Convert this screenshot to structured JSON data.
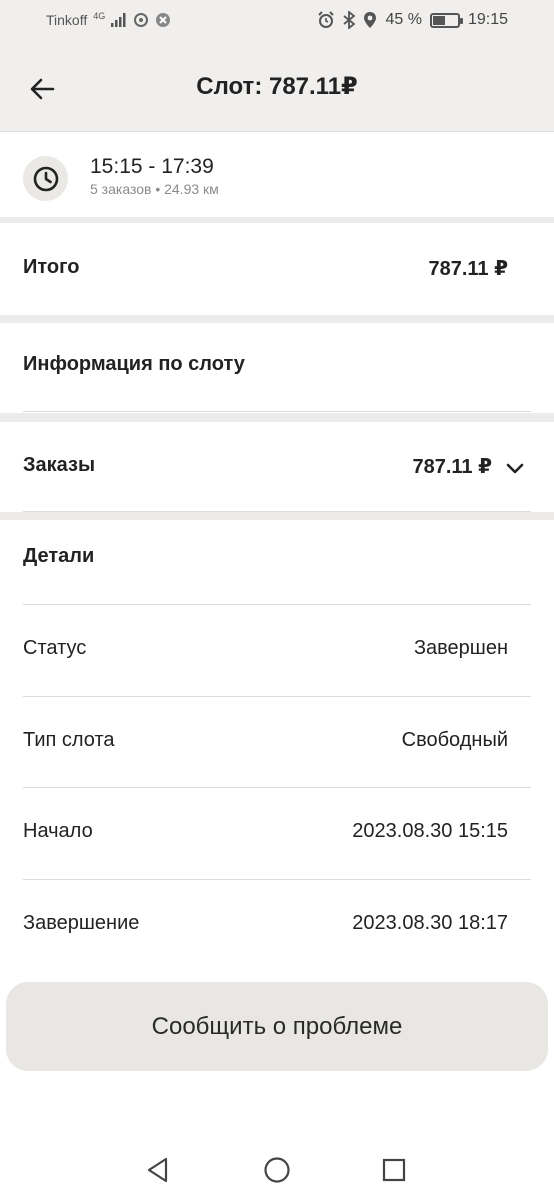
{
  "status_bar": {
    "carrier": "Tinkoff",
    "network": "4G",
    "battery": "45 %",
    "battery_level": 0.45,
    "time": "19:15"
  },
  "header": {
    "title": "Слот: 787.11₽"
  },
  "slot": {
    "time_range": "15:15 - 17:39",
    "summary": "5 заказов • 24.93 км"
  },
  "total": {
    "label": "Итого",
    "value": "787.11 ₽"
  },
  "slot_info": {
    "title": "Информация по слоту"
  },
  "orders": {
    "label": "Заказы",
    "value": "787.11 ₽"
  },
  "details": {
    "title": "Детали",
    "rows": [
      {
        "label": "Статус",
        "value": "Завершен"
      },
      {
        "label": "Тип слота",
        "value": "Свободный"
      },
      {
        "label": "Начало",
        "value": "2023.08.30 15:15"
      },
      {
        "label": "Завершение",
        "value": "2023.08.30 18:17"
      }
    ]
  },
  "report_button": {
    "label": "Сообщить о проблеме"
  },
  "icons": {
    "back": "arrow-left-icon",
    "clock": "clock-icon",
    "chevron": "chevron-down-icon"
  }
}
